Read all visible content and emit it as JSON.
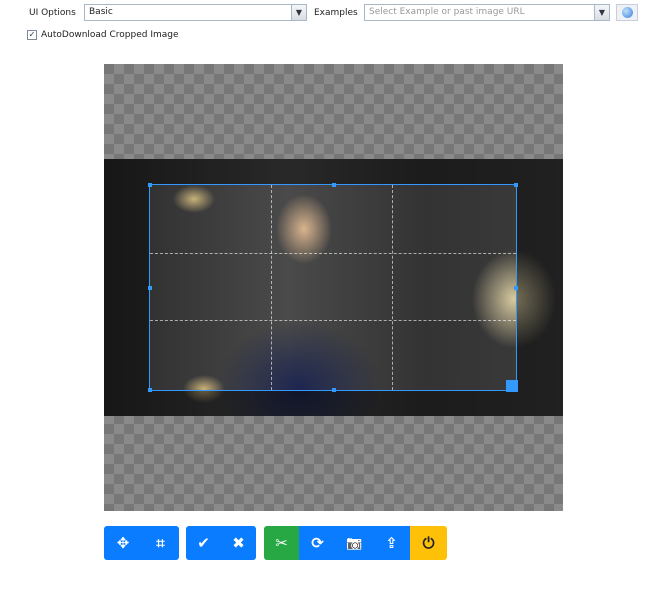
{
  "toolbar": {
    "ui_options_label": "UI Options",
    "ui_options_value": "Basic",
    "examples_label": "Examples",
    "examples_placeholder": "Select Example or past image URL",
    "autodownload_label": "AutoDownload Cropped Image",
    "autodownload_checked": true
  },
  "buttons": [
    {
      "name": "move",
      "icon": "✥"
    },
    {
      "name": "crop",
      "icon": "⌗"
    },
    {
      "name": "confirm",
      "icon": "✔"
    },
    {
      "name": "cancel",
      "icon": "✖"
    },
    {
      "name": "cut",
      "icon": "✂"
    },
    {
      "name": "rotate",
      "icon": "⟳"
    },
    {
      "name": "camera",
      "icon": "📷"
    },
    {
      "name": "upload",
      "icon": "⇪"
    },
    {
      "name": "power",
      "icon": "⏻"
    }
  ],
  "colors": {
    "blue": "#0a7cff",
    "green": "#28a745",
    "yellow": "#ffc107",
    "crop_border": "#3399ff"
  }
}
